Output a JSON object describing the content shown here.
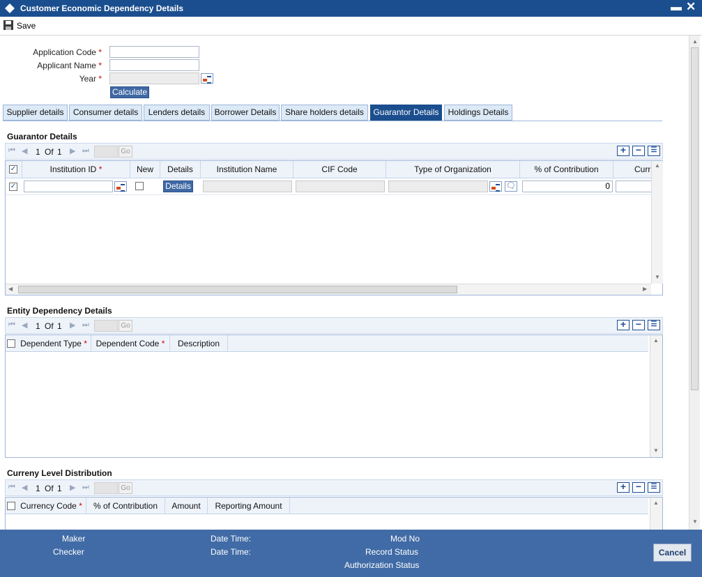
{
  "window": {
    "title": "Customer Economic Dependency Details"
  },
  "toolbar": {
    "save_label": "Save"
  },
  "form": {
    "application_code_label": "Application Code",
    "applicant_name_label": "Applicant Name",
    "year_label": "Year",
    "required_mark": "*",
    "application_code_value": "",
    "applicant_name_value": "",
    "year_value": "",
    "calculate_label": "Calculate"
  },
  "tabs": [
    {
      "label": "Supplier details"
    },
    {
      "label": "Consumer details"
    },
    {
      "label": "Lenders details"
    },
    {
      "label": "Borrower Details"
    },
    {
      "label": "Share holders details"
    },
    {
      "label": "Guarantor Details",
      "active": true
    },
    {
      "label": "Holdings Details"
    }
  ],
  "pager_text": {
    "current": "1",
    "of": "Of",
    "total": "1",
    "go": "Go"
  },
  "guarantor": {
    "title": "Guarantor Details",
    "columns": [
      "Institution ID",
      "New",
      "Details",
      "Institution Name",
      "CIF Code",
      "Type of Organization",
      "% of Contribution",
      "Curr"
    ],
    "row": {
      "details_button": "Details",
      "contribution": "0",
      "checked": true
    }
  },
  "entity": {
    "title": "Entity Dependency Details",
    "columns": [
      "Dependent Type",
      "Dependent Code",
      "Description"
    ]
  },
  "currency": {
    "title": "Curreny Level Distribution",
    "columns": [
      "Currency Code",
      "% of Contribution",
      "Amount",
      "Reporting Amount"
    ]
  },
  "footer": {
    "maker": "Maker",
    "checker": "Checker",
    "date_time_1": "Date Time:",
    "date_time_2": "Date Time:",
    "mod_no": "Mod No",
    "record_status": "Record Status",
    "authorization_status": "Authorization Status",
    "cancel": "Cancel"
  },
  "colors": {
    "title_bar": "#1b4e8e",
    "footer": "#416ba6",
    "active_tab": "#1b4e8e",
    "required": "#cc0000"
  }
}
